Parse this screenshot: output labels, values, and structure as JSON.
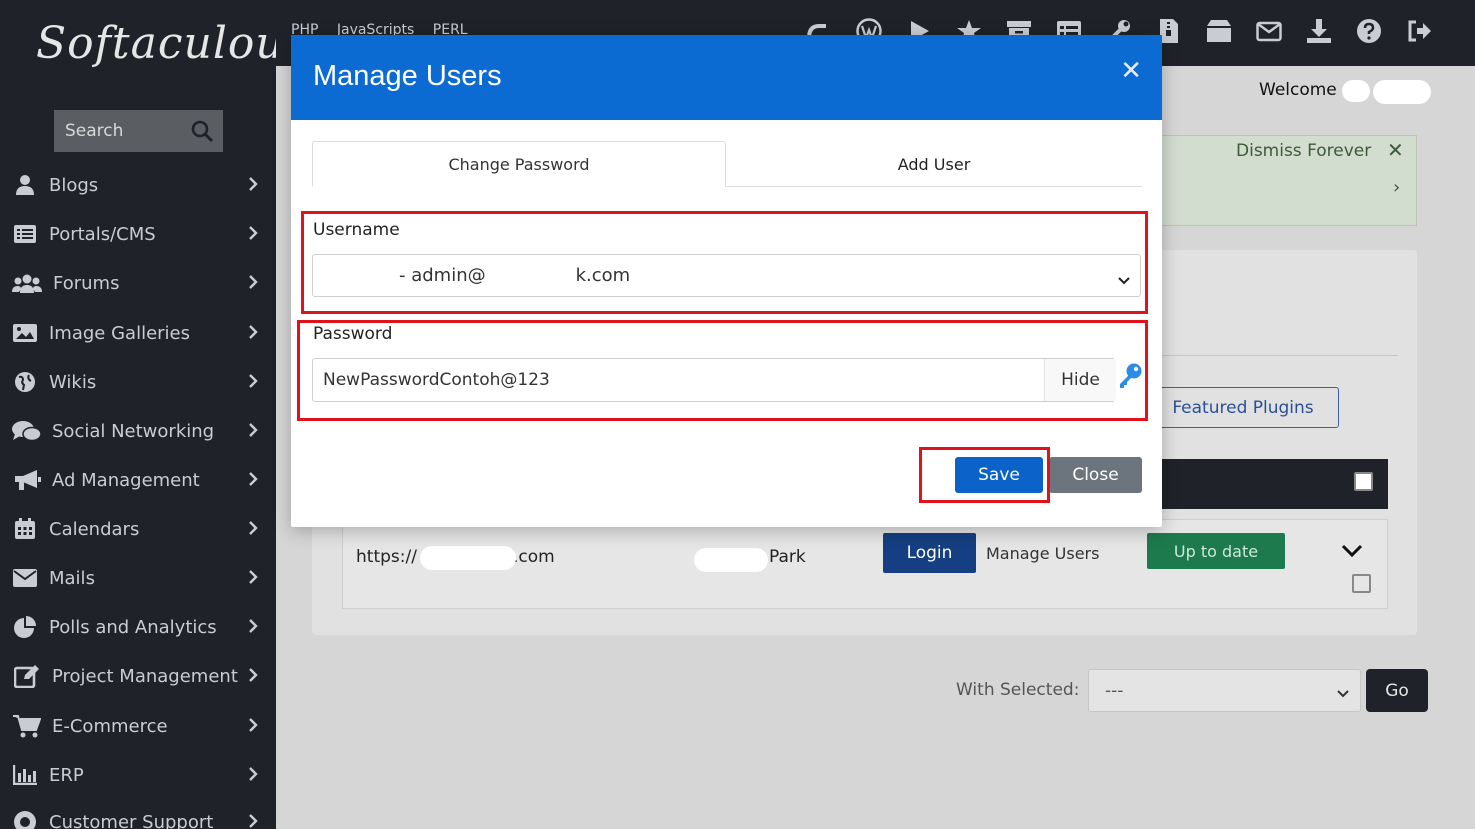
{
  "app": {
    "logo_text": "Softaculous"
  },
  "sidebar": {
    "search_placeholder": "Search",
    "items": [
      {
        "label": "Blogs",
        "icon": "user-icon"
      },
      {
        "label": "Portals/CMS",
        "icon": "list-icon"
      },
      {
        "label": "Forums",
        "icon": "users-icon"
      },
      {
        "label": "Image Galleries",
        "icon": "image-icon"
      },
      {
        "label": "Wikis",
        "icon": "globe-icon"
      },
      {
        "label": "Social Networking",
        "icon": "comments-icon"
      },
      {
        "label": "Ad Management",
        "icon": "bullhorn-icon"
      },
      {
        "label": "Calendars",
        "icon": "calendar-icon"
      },
      {
        "label": "Mails",
        "icon": "envelope-icon"
      },
      {
        "label": "Polls and Analytics",
        "icon": "pie-chart-icon"
      },
      {
        "label": "Project Management",
        "icon": "edit-icon"
      },
      {
        "label": "E-Commerce",
        "icon": "cart-icon"
      },
      {
        "label": "ERP",
        "icon": "bar-chart-icon"
      },
      {
        "label": "Customer Support",
        "icon": "support-icon"
      }
    ]
  },
  "topbar": {
    "nav": "PHP JavaScripts PERL",
    "icons": [
      "cpanel-icon",
      "wordpress-icon",
      "play-icon",
      "star-icon",
      "archive-icon",
      "list-icon",
      "wrench-icon",
      "file-zip-icon",
      "box-icon",
      "envelope-icon",
      "download-icon",
      "help-icon",
      "logout-icon"
    ]
  },
  "header": {
    "welcome": "Welcome"
  },
  "alert": {
    "dismiss_label": "Dismiss Forever"
  },
  "background": {
    "featured_plugins": "Featured Plugins",
    "row": {
      "url_prefix": "https://",
      "url_suffix": ".com",
      "name_suffix": "Park",
      "login_label": "Login",
      "manage_users_label": "Manage Users",
      "status_label": "Up to date"
    },
    "with_selected_label": "With Selected:",
    "with_selected_value": "---",
    "go_label": "Go"
  },
  "modal": {
    "title": "Manage Users",
    "tabs": [
      {
        "label": "Change Password",
        "active": true
      },
      {
        "label": "Add User",
        "active": false
      }
    ],
    "username_label": "Username",
    "username_value": "- admin@",
    "username_domain": "k.com",
    "password_label": "Password",
    "password_value": "NewPasswordContoh@123",
    "hide_label": "Hide",
    "save_label": "Save",
    "close_label": "Close"
  },
  "colors": {
    "accent": "#0b6bd3",
    "sidebar_bg": "#1f2329",
    "highlight": "#e0121c",
    "success": "#1d7a4c"
  }
}
